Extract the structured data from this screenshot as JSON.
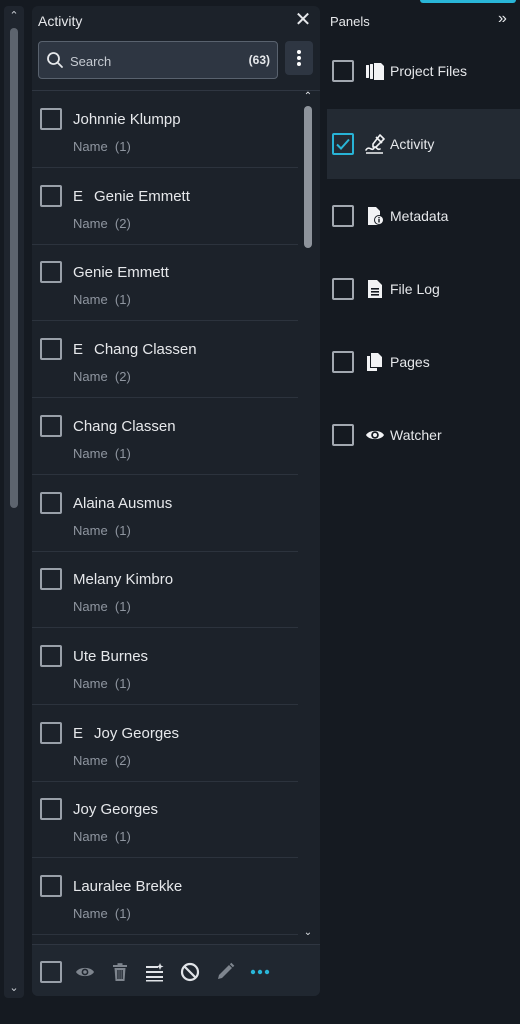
{
  "activity_panel": {
    "title": "Activity",
    "search": {
      "placeholder": "Search",
      "count": "(63)"
    },
    "items": [
      {
        "prefix": "",
        "name": "Johnnie Klumpp",
        "sub": "Name  (1)"
      },
      {
        "prefix": "E",
        "name": "Genie Emmett",
        "sub": "Name  (2)"
      },
      {
        "prefix": "",
        "name": "Genie Emmett",
        "sub": "Name  (1)"
      },
      {
        "prefix": "E",
        "name": "Chang Classen",
        "sub": "Name  (2)"
      },
      {
        "prefix": "",
        "name": "Chang Classen",
        "sub": "Name  (1)"
      },
      {
        "prefix": "",
        "name": "Alaina Ausmus",
        "sub": "Name  (1)"
      },
      {
        "prefix": "",
        "name": "Melany Kimbro",
        "sub": "Name  (1)"
      },
      {
        "prefix": "",
        "name": "Ute Burnes",
        "sub": "Name  (1)"
      },
      {
        "prefix": "E",
        "name": "Joy Georges",
        "sub": "Name  (2)"
      },
      {
        "prefix": "",
        "name": "Joy Georges",
        "sub": "Name  (1)"
      },
      {
        "prefix": "",
        "name": "Lauralee Brekke",
        "sub": "Name  (1)"
      }
    ],
    "toolbar_icons": [
      "eye-icon",
      "trash-icon",
      "list-edit-icon",
      "block-icon",
      "pencil-icon",
      "more-horizontal-icon"
    ]
  },
  "panels": {
    "title": "Panels",
    "items": [
      {
        "label": "Project Files",
        "icon": "project-files-icon",
        "checked": false
      },
      {
        "label": "Activity",
        "icon": "activity-signature-icon",
        "checked": true
      },
      {
        "label": "Metadata",
        "icon": "metadata-icon",
        "checked": false
      },
      {
        "label": "File Log",
        "icon": "file-log-icon",
        "checked": false
      },
      {
        "label": "Pages",
        "icon": "pages-icon",
        "checked": false
      },
      {
        "label": "Watcher",
        "icon": "eye-icon",
        "checked": false
      }
    ]
  },
  "colors": {
    "background": "#151a21",
    "panel": "#1c222a",
    "accent": "#29b6d8",
    "text": "#e6e8eb",
    "muted": "#8f96a0"
  }
}
